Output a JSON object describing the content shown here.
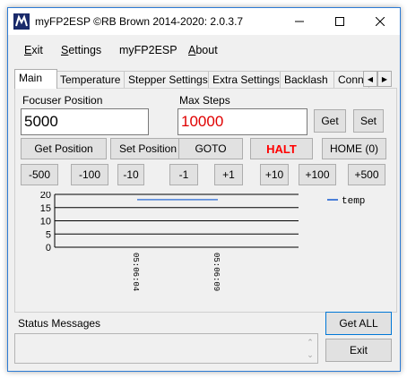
{
  "window": {
    "title": "myFP2ESP ©RB Brown 2014-2020: 2.0.3.7",
    "minimize_icon": "minimize-icon",
    "maximize_icon": "maximize-icon",
    "close_icon": "close-icon"
  },
  "menu": [
    {
      "label": "Exit",
      "underline": "E",
      "rest": "xit"
    },
    {
      "label": "Settings",
      "underline": "S",
      "rest": "ettings"
    },
    {
      "label": "myFP2ESP",
      "underline": "",
      "rest": "myFP2ESP"
    },
    {
      "label": "About",
      "underline": "A",
      "rest": "bout"
    }
  ],
  "tabs": [
    "Main",
    "Temperature",
    "Stepper Settings",
    "Extra Settings",
    "Backlash",
    "Conn"
  ],
  "main": {
    "focuser_position_label": "Focuser Position",
    "focuser_position_value": "5000",
    "max_steps_label": "Max Steps",
    "max_steps_value": "10000",
    "max_steps_color": "#e00000",
    "get_label": "Get",
    "set_label": "Set",
    "get_position_label": "Get Position",
    "set_position_label": "Set Position",
    "goto_label": "GOTO",
    "halt_label": "HALT",
    "home_label": "HOME (0)",
    "step_buttons": [
      "-500",
      "-100",
      "-10",
      "-1",
      "+1",
      "+10",
      "+100",
      "+500"
    ]
  },
  "chart_data": {
    "type": "line",
    "x": [
      "05:06:04",
      "05:06:09"
    ],
    "series": [
      {
        "name": "temp",
        "values": [
          18,
          18
        ],
        "color": "#4a7fd8"
      }
    ],
    "yticks": [
      0,
      5,
      10,
      15,
      20
    ],
    "ylim": [
      0,
      20
    ],
    "grid": true,
    "legend": "top-right"
  },
  "status": {
    "label": "Status Messages",
    "get_all_label": "Get ALL",
    "exit_label": "Exit"
  }
}
